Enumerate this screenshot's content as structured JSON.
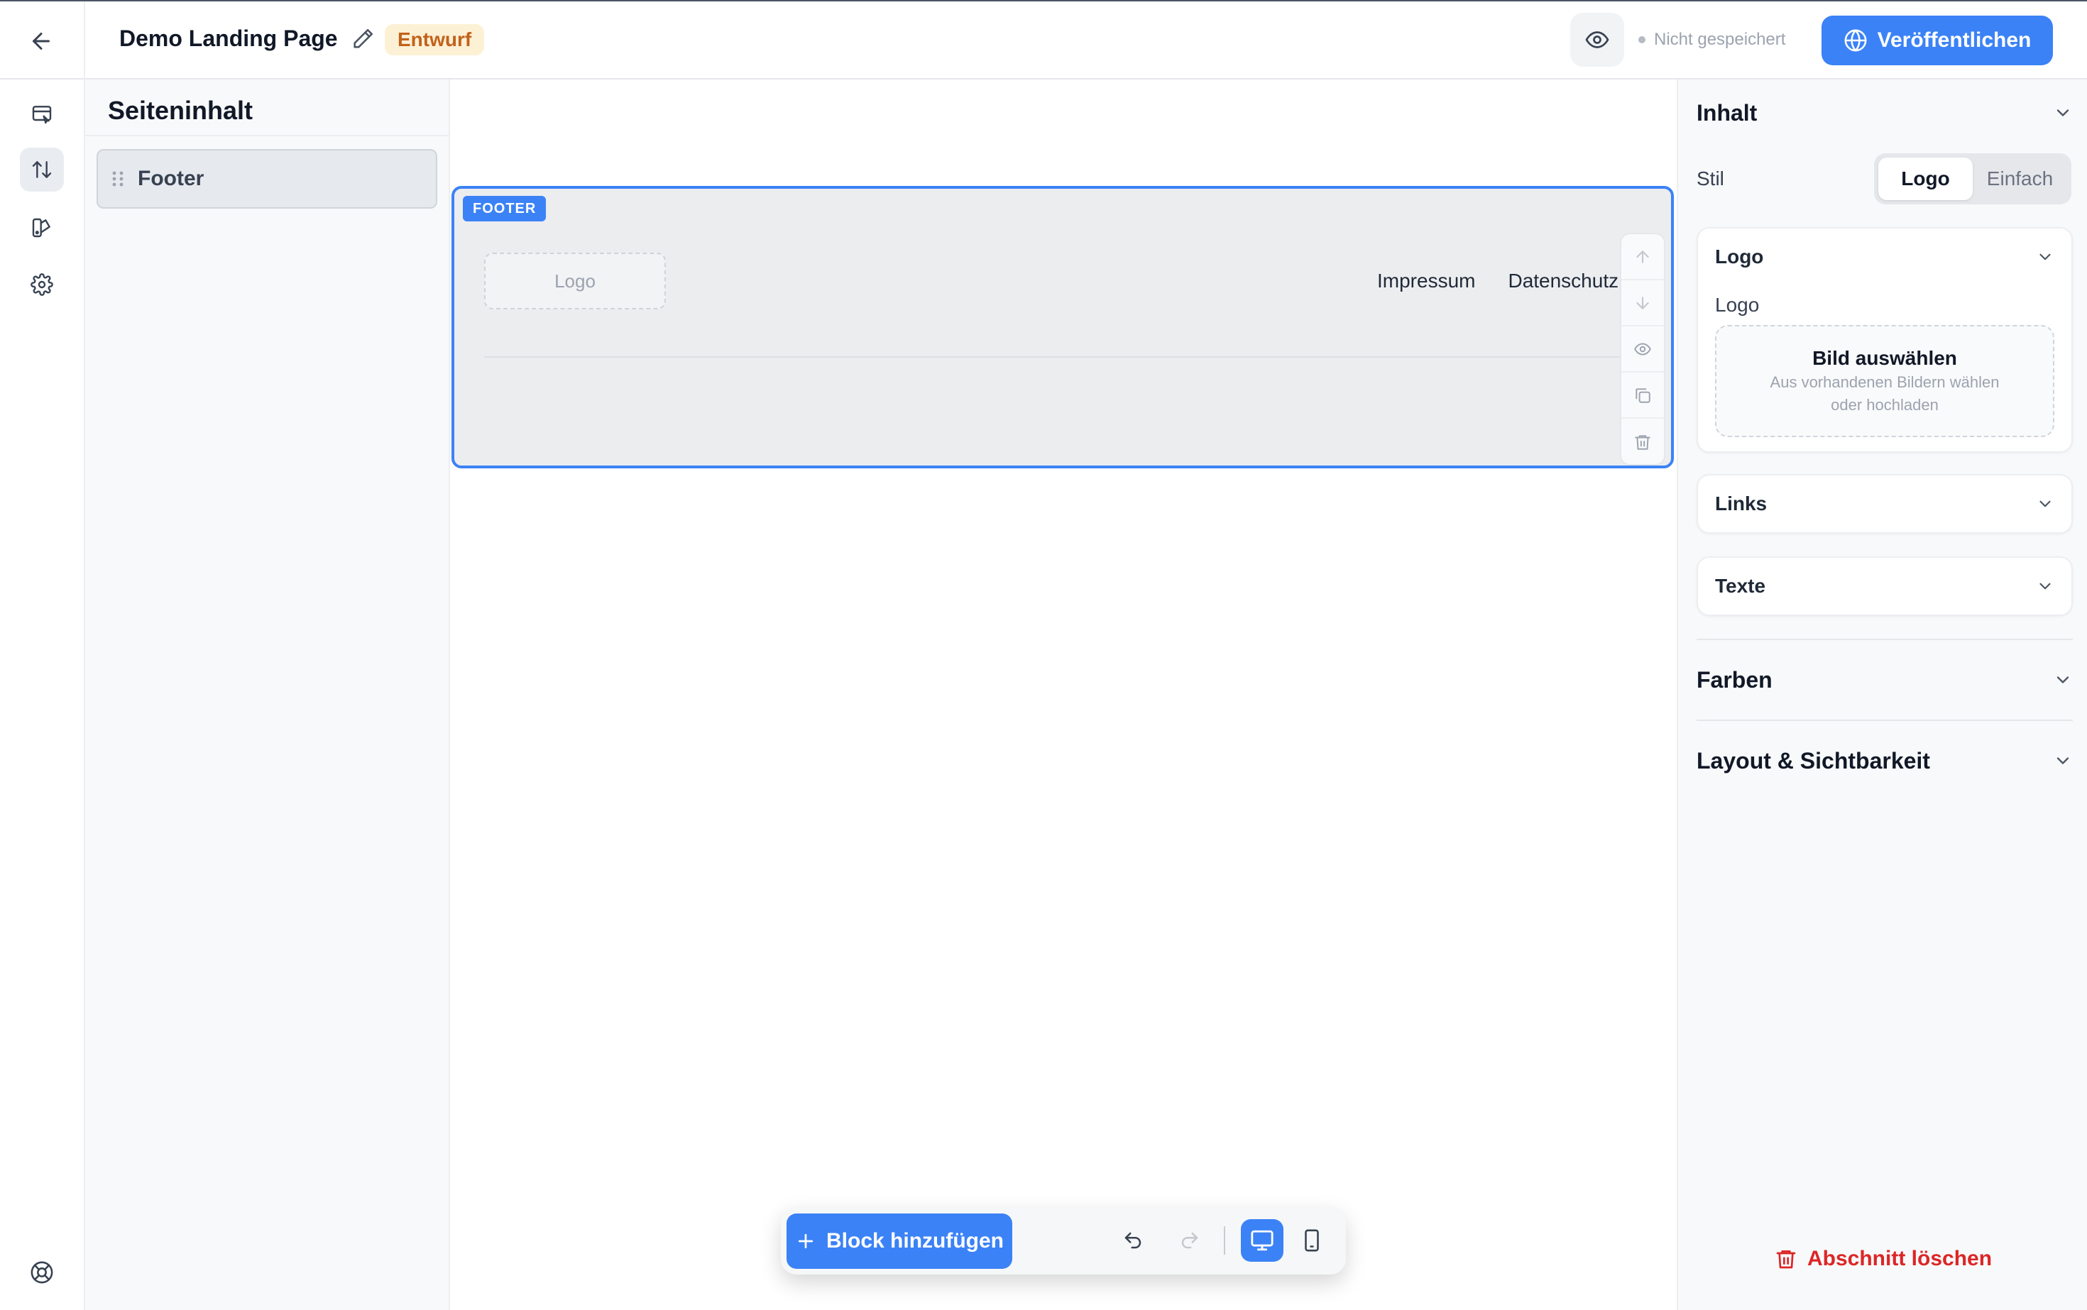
{
  "header": {
    "page_title": "Demo Landing Page",
    "status_badge": "Entwurf",
    "save_status": "Nicht gespeichert",
    "publish_label": "Veröffentlichen"
  },
  "left_panel": {
    "title": "Seiteninhalt",
    "sections": [
      "Footer"
    ]
  },
  "canvas": {
    "block_tag": "FOOTER",
    "logo_placeholder": "Logo",
    "footer_links": [
      "Impressum",
      "Datenschutz"
    ]
  },
  "bottom_bar": {
    "add_block_label": "Block hinzufügen"
  },
  "right_panel": {
    "content_title": "Inhalt",
    "style_label": "Stil",
    "style_options": [
      "Logo",
      "Einfach"
    ],
    "style_selected": "Logo",
    "logo_card": {
      "title": "Logo",
      "field_label": "Logo",
      "dropzone_title": "Bild auswählen",
      "dropzone_subtitle": "Aus vorhandenen Bildern wählen oder hochladen"
    },
    "links_card_title": "Links",
    "texts_card_title": "Texte",
    "colors_title": "Farben",
    "layout_title": "Layout & Sichtbarkeit",
    "delete_label": "Abschnitt löschen"
  },
  "colors": {
    "accent": "#3b82f6",
    "draft_badge_bg": "#fdf1d5",
    "draft_badge_text": "#c2621b",
    "danger": "#dc2626"
  },
  "icons": [
    "arrow-left-icon",
    "pencil-icon",
    "eye-icon",
    "globe-icon",
    "layout-icon",
    "sort-icon",
    "palette-icon",
    "gear-icon",
    "lifebuoy-icon",
    "drag-handle-icon",
    "arrow-up-icon",
    "arrow-down-icon",
    "copy-icon",
    "trash-icon",
    "plus-icon",
    "undo-icon",
    "redo-icon",
    "desktop-icon",
    "tablet-icon",
    "chevron-down-icon"
  ]
}
